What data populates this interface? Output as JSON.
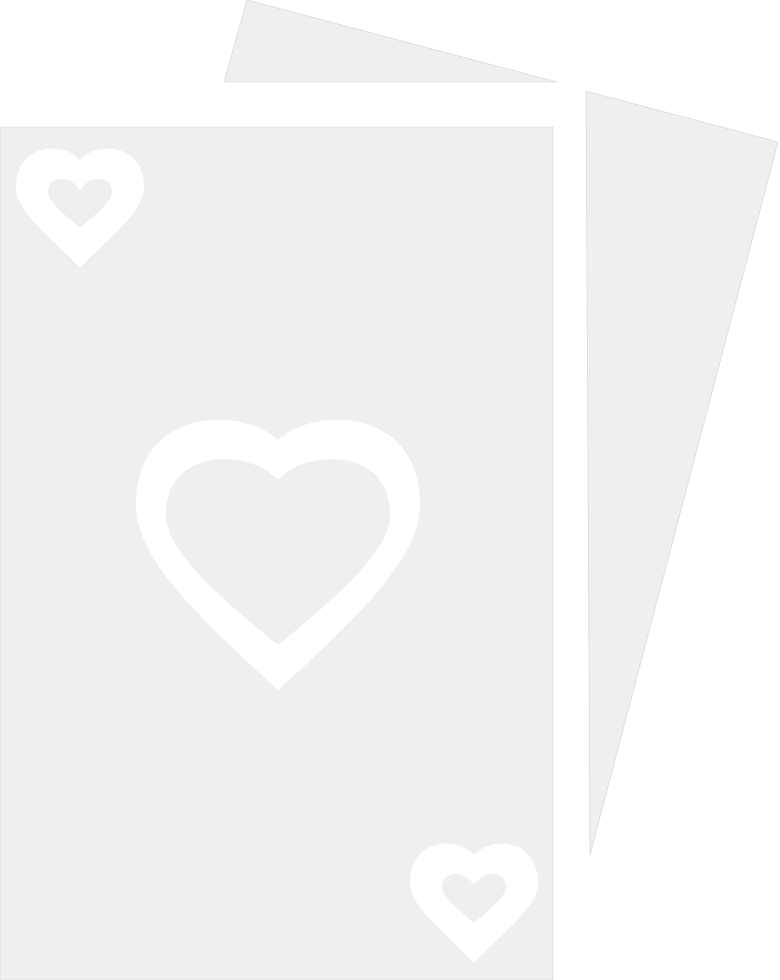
{
  "icon": {
    "name": "playing-cards-icon",
    "suit": "hearts",
    "card_count": 3
  },
  "colors": {
    "background": "#ffffff",
    "card_fill": "#efefef",
    "heart_outline": "#ffffff",
    "edge": "#d2d2d2"
  }
}
